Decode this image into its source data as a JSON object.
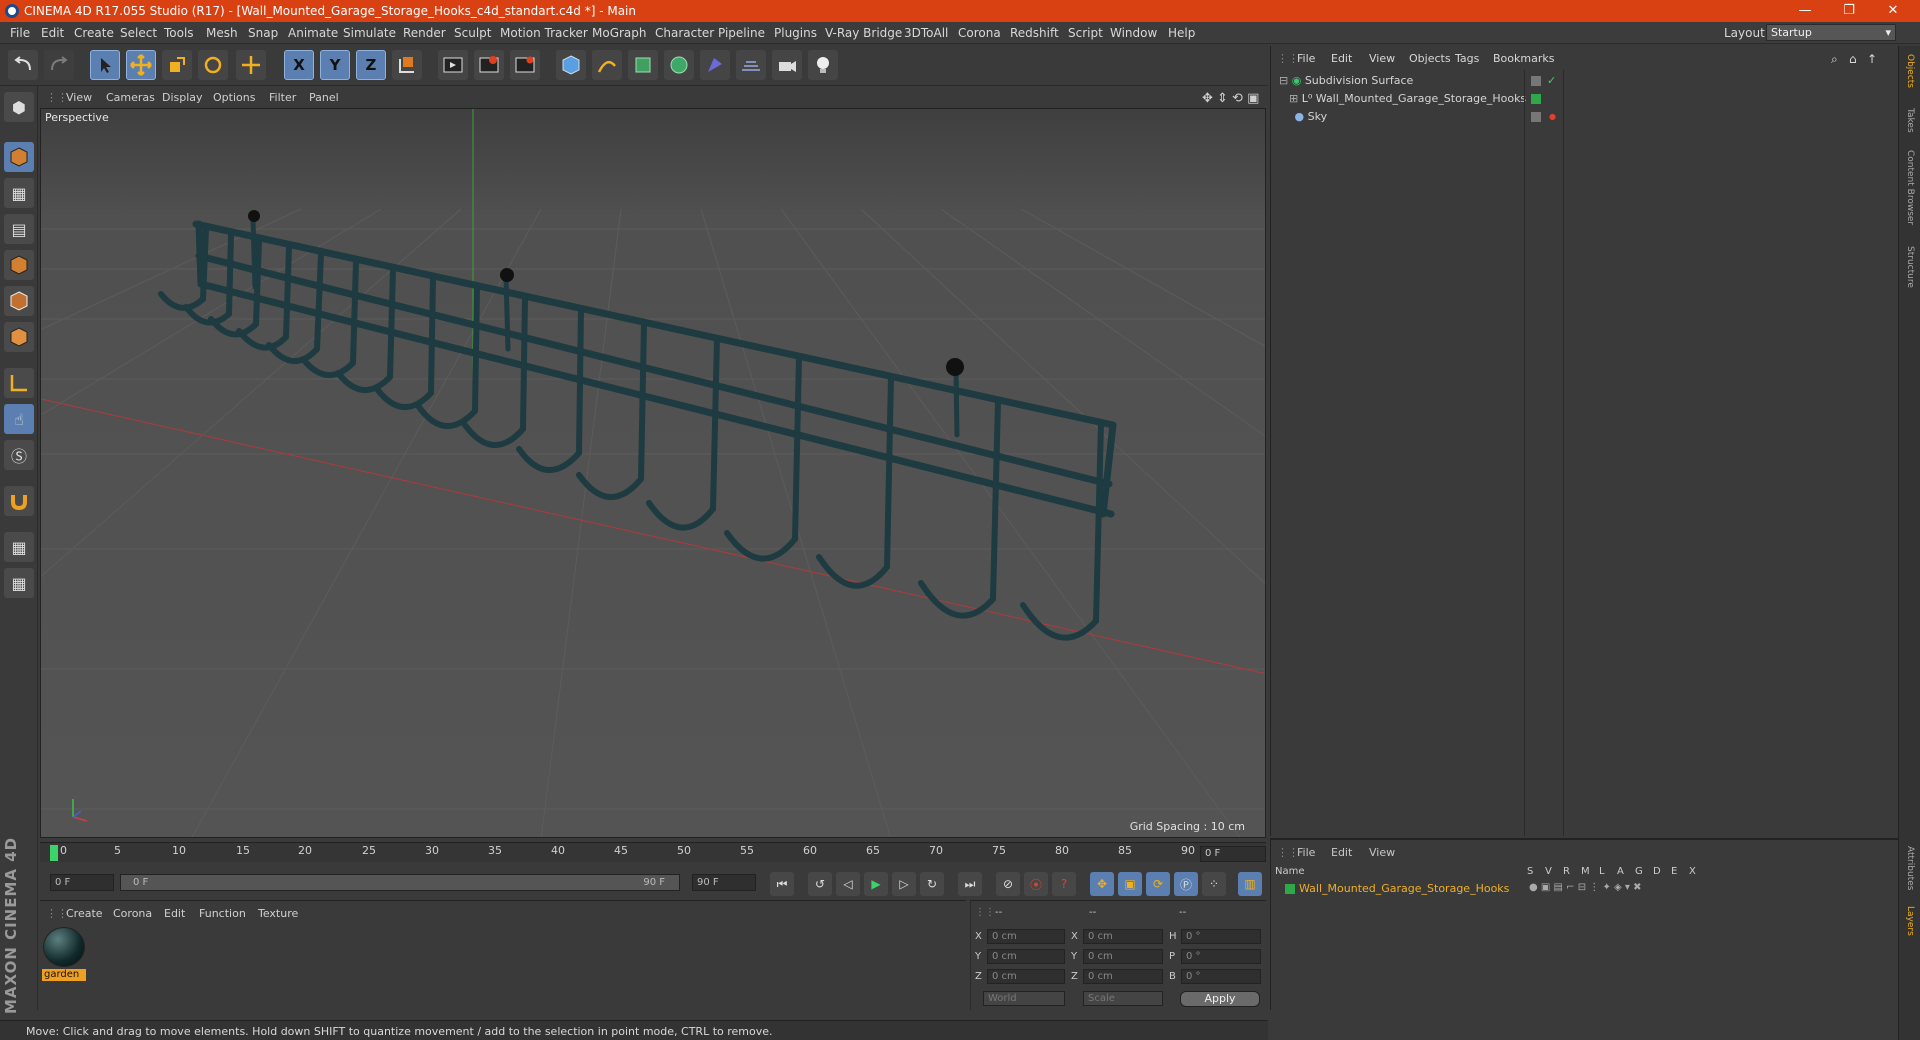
{
  "title": "CINEMA 4D R17.055 Studio (R17) - [Wall_Mounted_Garage_Storage_Hooks_c4d_standart.c4d *] - Main",
  "window_controls": {
    "minimize": "—",
    "maximize": "❐",
    "close": "✕"
  },
  "menubar": [
    "File",
    "Edit",
    "Create",
    "Select",
    "Tools",
    "Mesh",
    "Snap",
    "Animate",
    "Simulate",
    "Render",
    "Sculpt",
    "Motion Tracker",
    "MoGraph",
    "Character",
    "Pipeline",
    "Plugins",
    "V-Ray Bridge",
    "3DToAll",
    "Corona",
    "Redshift",
    "Script",
    "Window",
    "Help"
  ],
  "layout": {
    "label": "Layout:",
    "value": "Startup"
  },
  "toolbar": {
    "axis_x": "X",
    "axis_y": "Y",
    "axis_z": "Z"
  },
  "viewport": {
    "menu": [
      "View",
      "Cameras",
      "Display",
      "Options",
      "Filter",
      "Panel"
    ],
    "label": "Perspective",
    "grid_spacing": "Grid Spacing : 10 cm"
  },
  "timeline": {
    "ticks": [
      "0",
      "5",
      "10",
      "15",
      "20",
      "25",
      "30",
      "35",
      "40",
      "45",
      "50",
      "55",
      "60",
      "65",
      "70",
      "75",
      "80",
      "85",
      "90"
    ],
    "current_frame": "0 F",
    "start_field": "0 F",
    "range_start": "0 F",
    "range_end": "90 F",
    "end_field": "90 F"
  },
  "material_manager": {
    "menu": [
      "Create",
      "Corona",
      "Edit",
      "Function",
      "Texture"
    ],
    "material_name": "garden"
  },
  "coordinates": {
    "header": [
      "--",
      "--",
      "--"
    ],
    "rows": [
      {
        "a": "X",
        "av": "0 cm",
        "b": "X",
        "bv": "0 cm",
        "c": "H",
        "cv": "0 °"
      },
      {
        "a": "Y",
        "av": "0 cm",
        "b": "Y",
        "bv": "0 cm",
        "c": "P",
        "cv": "0 °"
      },
      {
        "a": "Z",
        "av": "0 cm",
        "b": "Z",
        "bv": "0 cm",
        "c": "B",
        "cv": "0 °"
      }
    ],
    "world": "World",
    "scale": "Scale",
    "apply": "Apply"
  },
  "brand": "MAXON CINEMA 4D",
  "status": "Move: Click and drag to move elements. Hold down SHIFT to quantize movement / add to the selection in point mode, CTRL to remove.",
  "objects_panel": {
    "menu": [
      "File",
      "Edit",
      "View",
      "Objects",
      "Tags",
      "Bookmarks"
    ],
    "items": [
      {
        "name": "Subdivision Surface",
        "indent": 0
      },
      {
        "name": "Wall_Mounted_Garage_Storage_Hooks",
        "indent": 1
      },
      {
        "name": "Sky",
        "indent": 0
      }
    ]
  },
  "layers_panel": {
    "menu": [
      "File",
      "Edit",
      "View"
    ],
    "columns": [
      "Name",
      "S",
      "V",
      "R",
      "M",
      "L",
      "A",
      "G",
      "D",
      "E",
      "X"
    ],
    "row": "Wall_Mounted_Garage_Storage_Hooks"
  },
  "right_tabs": [
    "Objects",
    "Takes",
    "Content Browser",
    "Structure",
    "Attributes",
    "Layers"
  ],
  "colors": {
    "title_bar": "#d94012",
    "accent": "#5a7fb0",
    "layer_green": "#2fa84a",
    "material_highlight": "#f0a020"
  }
}
